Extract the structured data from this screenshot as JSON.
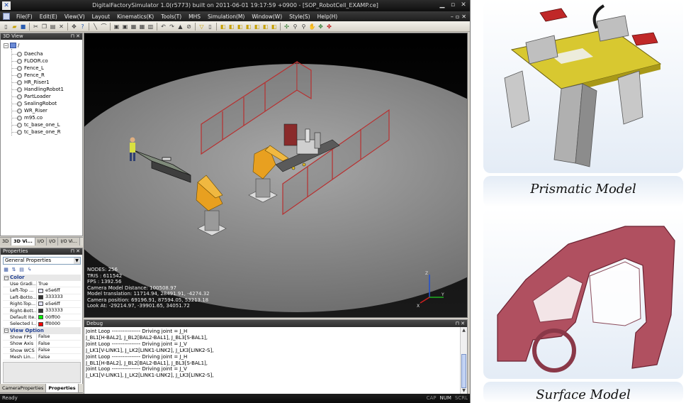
{
  "window": {
    "title": "DigitalFactorySimulator 1.0(r5773) built on 2011-06-01 19:17:59 +0900 - [SOP_RobotCell_EXAMP.ce]"
  },
  "menu": [
    "File(F)",
    "Edit(E)",
    "View(V)",
    "Layout",
    "Kinematics(K)",
    "Tools(T)",
    "MHS",
    "Simulation(M)",
    "Window(W)",
    "Style(S)",
    "Help(H)"
  ],
  "tree_panel": {
    "title": "3D View",
    "root": "/",
    "items": [
      "Daecha",
      "FLOOR.co",
      "Fence_L",
      "Fence_R",
      "HR_Riser1",
      "HandlingRobot1",
      "PartLoader",
      "SealingRobot",
      "WR_Riser",
      "m95.co",
      "tc_base_one_L",
      "tc_base_one_R"
    ]
  },
  "left_tabs": [
    "3D",
    "3D Vi...",
    "I/O",
    "I/O",
    "I/O Vi..."
  ],
  "properties": {
    "title": "Properties",
    "selector": "General Properties",
    "categories": [
      {
        "name": "Color",
        "rows": [
          {
            "name": "Use Gradi...",
            "value": "True",
            "swatch": ""
          },
          {
            "name": "Left-Top ...",
            "value": "e5e6ff",
            "swatch": "#e5e6ff"
          },
          {
            "name": "Left-Botto...",
            "value": "333333",
            "swatch": "#333333"
          },
          {
            "name": "Right-Top...",
            "value": "e5e6ff",
            "swatch": "#e5e6ff"
          },
          {
            "name": "Right-Bott...",
            "value": "333333",
            "swatch": "#333333"
          },
          {
            "name": "Default Ite...",
            "value": "00ff00",
            "swatch": "#00ff00"
          },
          {
            "name": "Selected I...",
            "value": "ff0000",
            "swatch": "#ff0000"
          }
        ]
      },
      {
        "name": "View Option",
        "rows": [
          {
            "name": "Show FPS",
            "value": "False",
            "swatch": ""
          },
          {
            "name": "Show Axis",
            "value": "False",
            "swatch": ""
          },
          {
            "name": "Show WCS",
            "value": "False",
            "swatch": ""
          },
          {
            "name": "Mesh Lin...",
            "value": "False",
            "swatch": ""
          }
        ]
      }
    ]
  },
  "bottom_tabs": [
    "CameraProperties",
    "Properties"
  ],
  "viewport_stats": [
    "NODES: 256",
    "TRIS    : 611542",
    "FPS      : 1392.56",
    "Camera Model Distance: 100508.97",
    "Model translation: 11714.94, 28491.91, -4274.32",
    "Camera position: 69196.91, 87594.05, 53213.18",
    "Look At: -29214.97, -39901.65, 34051.72"
  ],
  "debug": {
    "title": "Debug",
    "lines": [
      "Joint Loop ---------------- Driving joint = J_H",
      "J_BL1[H-BAL2], J_BL2[BAL2-BAL1], J_BL3[S-BAL1],",
      "Joint Loop ---------------- Driving joint = J_V",
      "J_LK1[V-LINK1], J_LK2[LINK1-LINK2], J_LK3[LINK2-S],",
      "Joint Loop ---------------- Driving joint = J_H",
      "J_BL1[H-BAL2], J_BL2[BAL2-BAL1], J_BL3[S-BAL1],",
      "Joint Loop ---------------- Driving joint = J_V",
      "J_LK1[V-LINK1], J_LK2[LINK1-LINK2], J_LK3[LINK2-S],"
    ]
  },
  "statusbar": {
    "text": "Ready",
    "indicators": [
      "CAP",
      "NUM",
      "SCRL"
    ]
  },
  "captions": {
    "prismatic": "Prismatic Model",
    "surface": "Surface Model"
  },
  "colors": {
    "robot": "#e8a020",
    "fence": "#b83030",
    "floor": "#8e8e8e",
    "car_body": "#b05060"
  }
}
